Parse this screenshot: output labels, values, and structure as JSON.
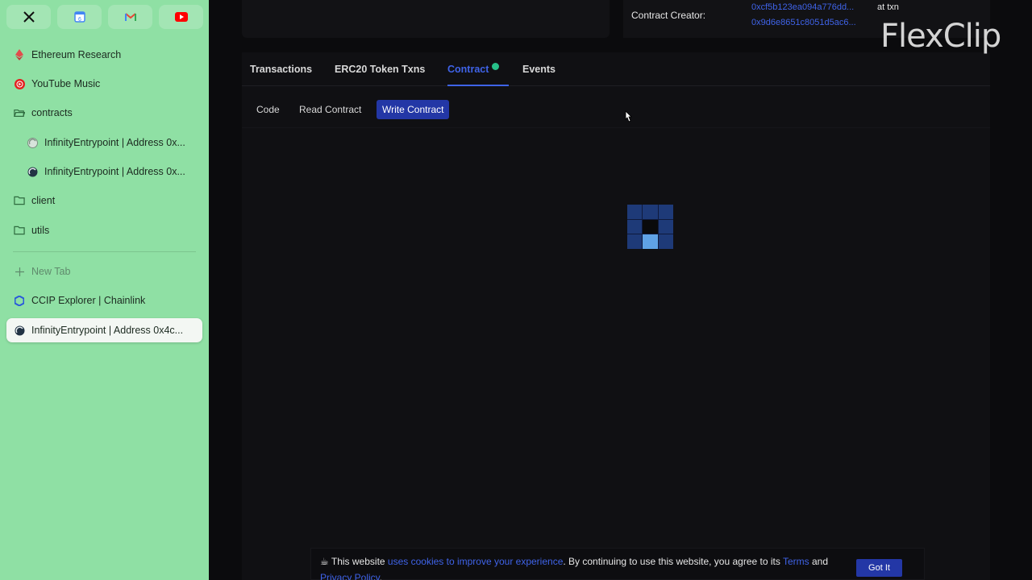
{
  "sidebar": {
    "pinned": [
      {
        "icon": "x-icon"
      },
      {
        "icon": "google-calendar-icon"
      },
      {
        "icon": "gmail-icon"
      },
      {
        "icon": "youtube-icon"
      }
    ],
    "items": [
      {
        "label": "Ethereum Research"
      },
      {
        "label": "YouTube Music"
      },
      {
        "label": "contracts"
      },
      {
        "label": "InfinityEntrypoint | Address 0x..."
      },
      {
        "label": "InfinityEntrypoint | Address 0x..."
      },
      {
        "label": "client"
      },
      {
        "label": "utils"
      },
      {
        "label": "New Tab"
      },
      {
        "label": "CCIP Explorer | Chainlink"
      },
      {
        "label": "InfinityEntrypoint | Address 0x4c..."
      }
    ]
  },
  "main": {
    "creator": {
      "label": "Contract Creator:",
      "address": "0xcf5b123ea094a776dd...",
      "at_txn": "at txn",
      "txn": "0x9d6e8651c8051d5ac6..."
    },
    "watermark": "FlexClip",
    "tabs": [
      {
        "label": "Transactions"
      },
      {
        "label": "ERC20 Token Txns"
      },
      {
        "label": "Contract"
      },
      {
        "label": "Events"
      }
    ],
    "subtabs": [
      {
        "label": "Code"
      },
      {
        "label": "Read Contract"
      },
      {
        "label": "Write Contract"
      }
    ]
  },
  "cookie": {
    "prefix": "This website ",
    "link1": "uses cookies to improve your experience",
    "middle": ". By continuing to use this website, you agree to its ",
    "link2": "Terms",
    "and": " and ",
    "link3": "Privacy Policy",
    "end": ".",
    "button": "Got It"
  },
  "colors": {
    "sidebar_bg": "#8fe0a4",
    "accent": "#3f63e8",
    "active_button": "#2337a6",
    "verified": "#27c089"
  }
}
